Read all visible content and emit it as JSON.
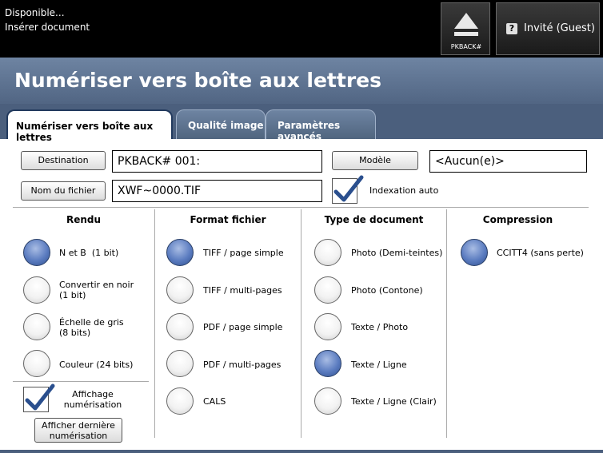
{
  "status": {
    "line1": "Disponible...",
    "line2": "Insérer document"
  },
  "header": {
    "eject_label": "PKBACK#",
    "guest_label": "Invité (Guest)",
    "guest_icon": "?"
  },
  "title": "Numériser vers boîte aux lettres",
  "tabs": [
    {
      "label": "Numériser vers boîte aux lettres",
      "active": true
    },
    {
      "label": "Qualité image",
      "active": false
    },
    {
      "label": "Paramètres avancés",
      "active": false
    }
  ],
  "form": {
    "destination_label": "Destination",
    "destination_value": "PKBACK# 001:",
    "filename_label": "Nom du fichier",
    "filename_value": "XWF~0000.TIF",
    "model_label": "Modèle",
    "model_value": "<Aucun(e)>",
    "auto_index_label": "Indexation auto",
    "auto_index_checked": true
  },
  "columns": {
    "rendu": {
      "title": "Rendu",
      "options": [
        {
          "label": "N et B  (1 bit)",
          "selected": true
        },
        {
          "label": "Convertir en noir\n(1 bit)",
          "selected": false
        },
        {
          "label": "Échelle de gris\n(8 bits)",
          "selected": false
        },
        {
          "label": "Couleur (24 bits)",
          "selected": false
        }
      ]
    },
    "format": {
      "title": "Format fichier",
      "options": [
        {
          "label": "TIFF / page simple",
          "selected": true
        },
        {
          "label": "TIFF / multi-pages",
          "selected": false
        },
        {
          "label": "PDF / page simple",
          "selected": false
        },
        {
          "label": "PDF / multi-pages",
          "selected": false
        },
        {
          "label": "CALS",
          "selected": false
        }
      ]
    },
    "type": {
      "title": "Type de document",
      "options": [
        {
          "label": "Photo (Demi-teintes)",
          "selected": false
        },
        {
          "label": "Photo (Contone)",
          "selected": false
        },
        {
          "label": "Texte / Photo",
          "selected": false
        },
        {
          "label": "Texte / Ligne",
          "selected": true
        },
        {
          "label": "Texte / Ligne (Clair)",
          "selected": false
        }
      ]
    },
    "compression": {
      "title": "Compression",
      "options": [
        {
          "label": "CCITT4 (sans perte)",
          "selected": true
        }
      ]
    }
  },
  "scan_display": {
    "label": "Affichage\nnumérisation",
    "checked": true
  },
  "last_scan_button": "Afficher dernière\nnumérisation",
  "colors": {
    "accent": "#4b5f7d",
    "radio_selected": "#5b7cc0"
  }
}
